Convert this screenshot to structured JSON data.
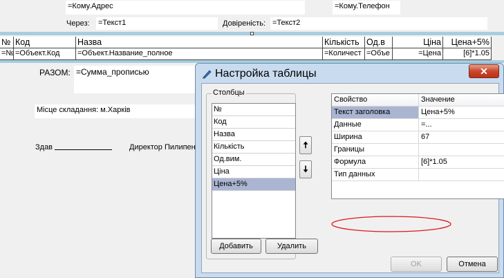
{
  "report": {
    "address_field": "=Кому.Адрес",
    "phone_field": "=Кому.Телефон",
    "via_label": "Через:",
    "via_value": "=Текст1",
    "proxy_label": "Довіреність:",
    "proxy_value": "=Текст2",
    "table": {
      "headers": [
        "№",
        "Код",
        "Назва",
        "Кількість",
        "Од.в",
        "Ціна",
        "Цена+5%"
      ],
      "row": [
        "=№",
        "=Объект.Код",
        "=Объект.Название_полное",
        "=Количест",
        "=Объе",
        "=Цена",
        "[6]*1.05"
      ]
    },
    "total_label": "РАЗОМ:",
    "total_value": "=Сумма_прописью",
    "place_label": "Місце складання: м.Харків",
    "handed_label": "Здав",
    "director_label": "Директор Пилипен"
  },
  "dialog": {
    "title": "Настройка таблицы",
    "close_label": "✕",
    "columns_group_title": "Столбцы",
    "columns": [
      "№",
      "Код",
      "Назва",
      "Кількість",
      "Од.вим.",
      "Ціна",
      "Цена+5%"
    ],
    "selected_column_index": 6,
    "up_arrow": "🠅",
    "down_arrow": "🠇",
    "add_button": "Добавить",
    "delete_button": "Удалить",
    "properties_header": [
      "Свойство",
      "Значение"
    ],
    "properties": [
      {
        "name": "Текст заголовка",
        "value": "Цена+5%"
      },
      {
        "name": "Данные",
        "value": "=..."
      },
      {
        "name": "Ширина",
        "value": "67"
      },
      {
        "name": "Границы",
        "value": ""
      },
      {
        "name": "Формула",
        "value": "[6]*1.05"
      },
      {
        "name": "Тип данных",
        "value": ""
      }
    ],
    "selected_property_index": 0,
    "highlight_property_index": 4,
    "highlight_color": "#e0141e",
    "ok_button": "OK",
    "cancel_button": "Отмена"
  }
}
